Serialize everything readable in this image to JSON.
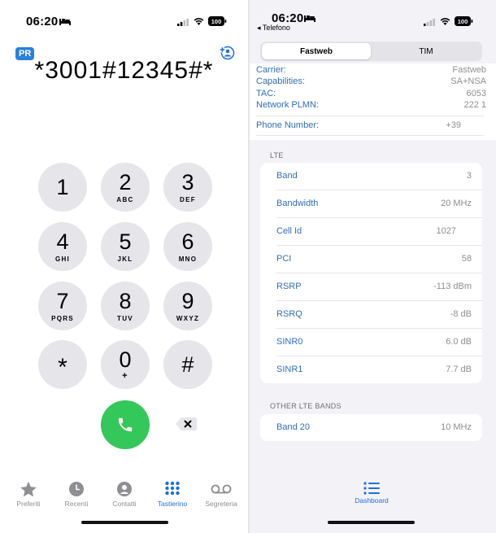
{
  "left": {
    "status": {
      "time": "06:20",
      "battery": "100"
    },
    "pr_badge": "PR",
    "dialed": "*3001#12345#*",
    "keys": [
      {
        "d": "1",
        "l": ""
      },
      {
        "d": "2",
        "l": "ABC"
      },
      {
        "d": "3",
        "l": "DEF"
      },
      {
        "d": "4",
        "l": "GHI"
      },
      {
        "d": "5",
        "l": "JKL"
      },
      {
        "d": "6",
        "l": "MNO"
      },
      {
        "d": "7",
        "l": "PQRS"
      },
      {
        "d": "8",
        "l": "TUV"
      },
      {
        "d": "9",
        "l": "WXYZ"
      },
      {
        "d": "*",
        "l": ""
      },
      {
        "d": "0",
        "l": "+"
      },
      {
        "d": "#",
        "l": ""
      }
    ],
    "tabs": [
      {
        "label": "Preferiti",
        "icon": "star-icon"
      },
      {
        "label": "Recenti",
        "icon": "clock-icon"
      },
      {
        "label": "Contatti",
        "icon": "person-icon"
      },
      {
        "label": "Tastierino",
        "icon": "keypad-icon",
        "active": true
      },
      {
        "label": "Segreteria",
        "icon": "voicemail-icon"
      }
    ]
  },
  "right": {
    "status": {
      "time": "06:20",
      "battery": "100",
      "back_label": "◂ Telefono"
    },
    "segment": {
      "selected": "Fastweb",
      "other": "TIM"
    },
    "info": [
      {
        "k": "Carrier:",
        "v": "Fastweb"
      },
      {
        "k": "Capabilities:",
        "v": "SA+NSA"
      },
      {
        "k": "TAC:",
        "v": "6053"
      },
      {
        "k": "Network PLMN:",
        "v": "222 1"
      },
      {
        "k": "Phone Number:",
        "v": "+39"
      }
    ],
    "lte_header": "LTE",
    "lte": [
      {
        "k": "Band",
        "v": "3"
      },
      {
        "k": "Bandwidth",
        "v": "20 MHz"
      },
      {
        "k": "Cell Id",
        "v": "1027"
      },
      {
        "k": "PCI",
        "v": "58"
      },
      {
        "k": "RSRP",
        "v": "-113 dBm"
      },
      {
        "k": "RSRQ",
        "v": "-8 dB"
      },
      {
        "k": "SINR0",
        "v": "6.0 dB"
      },
      {
        "k": "SINR1",
        "v": "7.7 dB"
      }
    ],
    "other_header": "OTHER LTE BANDS",
    "other": [
      {
        "k": "Band 20",
        "v": "10 MHz"
      }
    ],
    "dashboard_label": "Dashboard"
  }
}
